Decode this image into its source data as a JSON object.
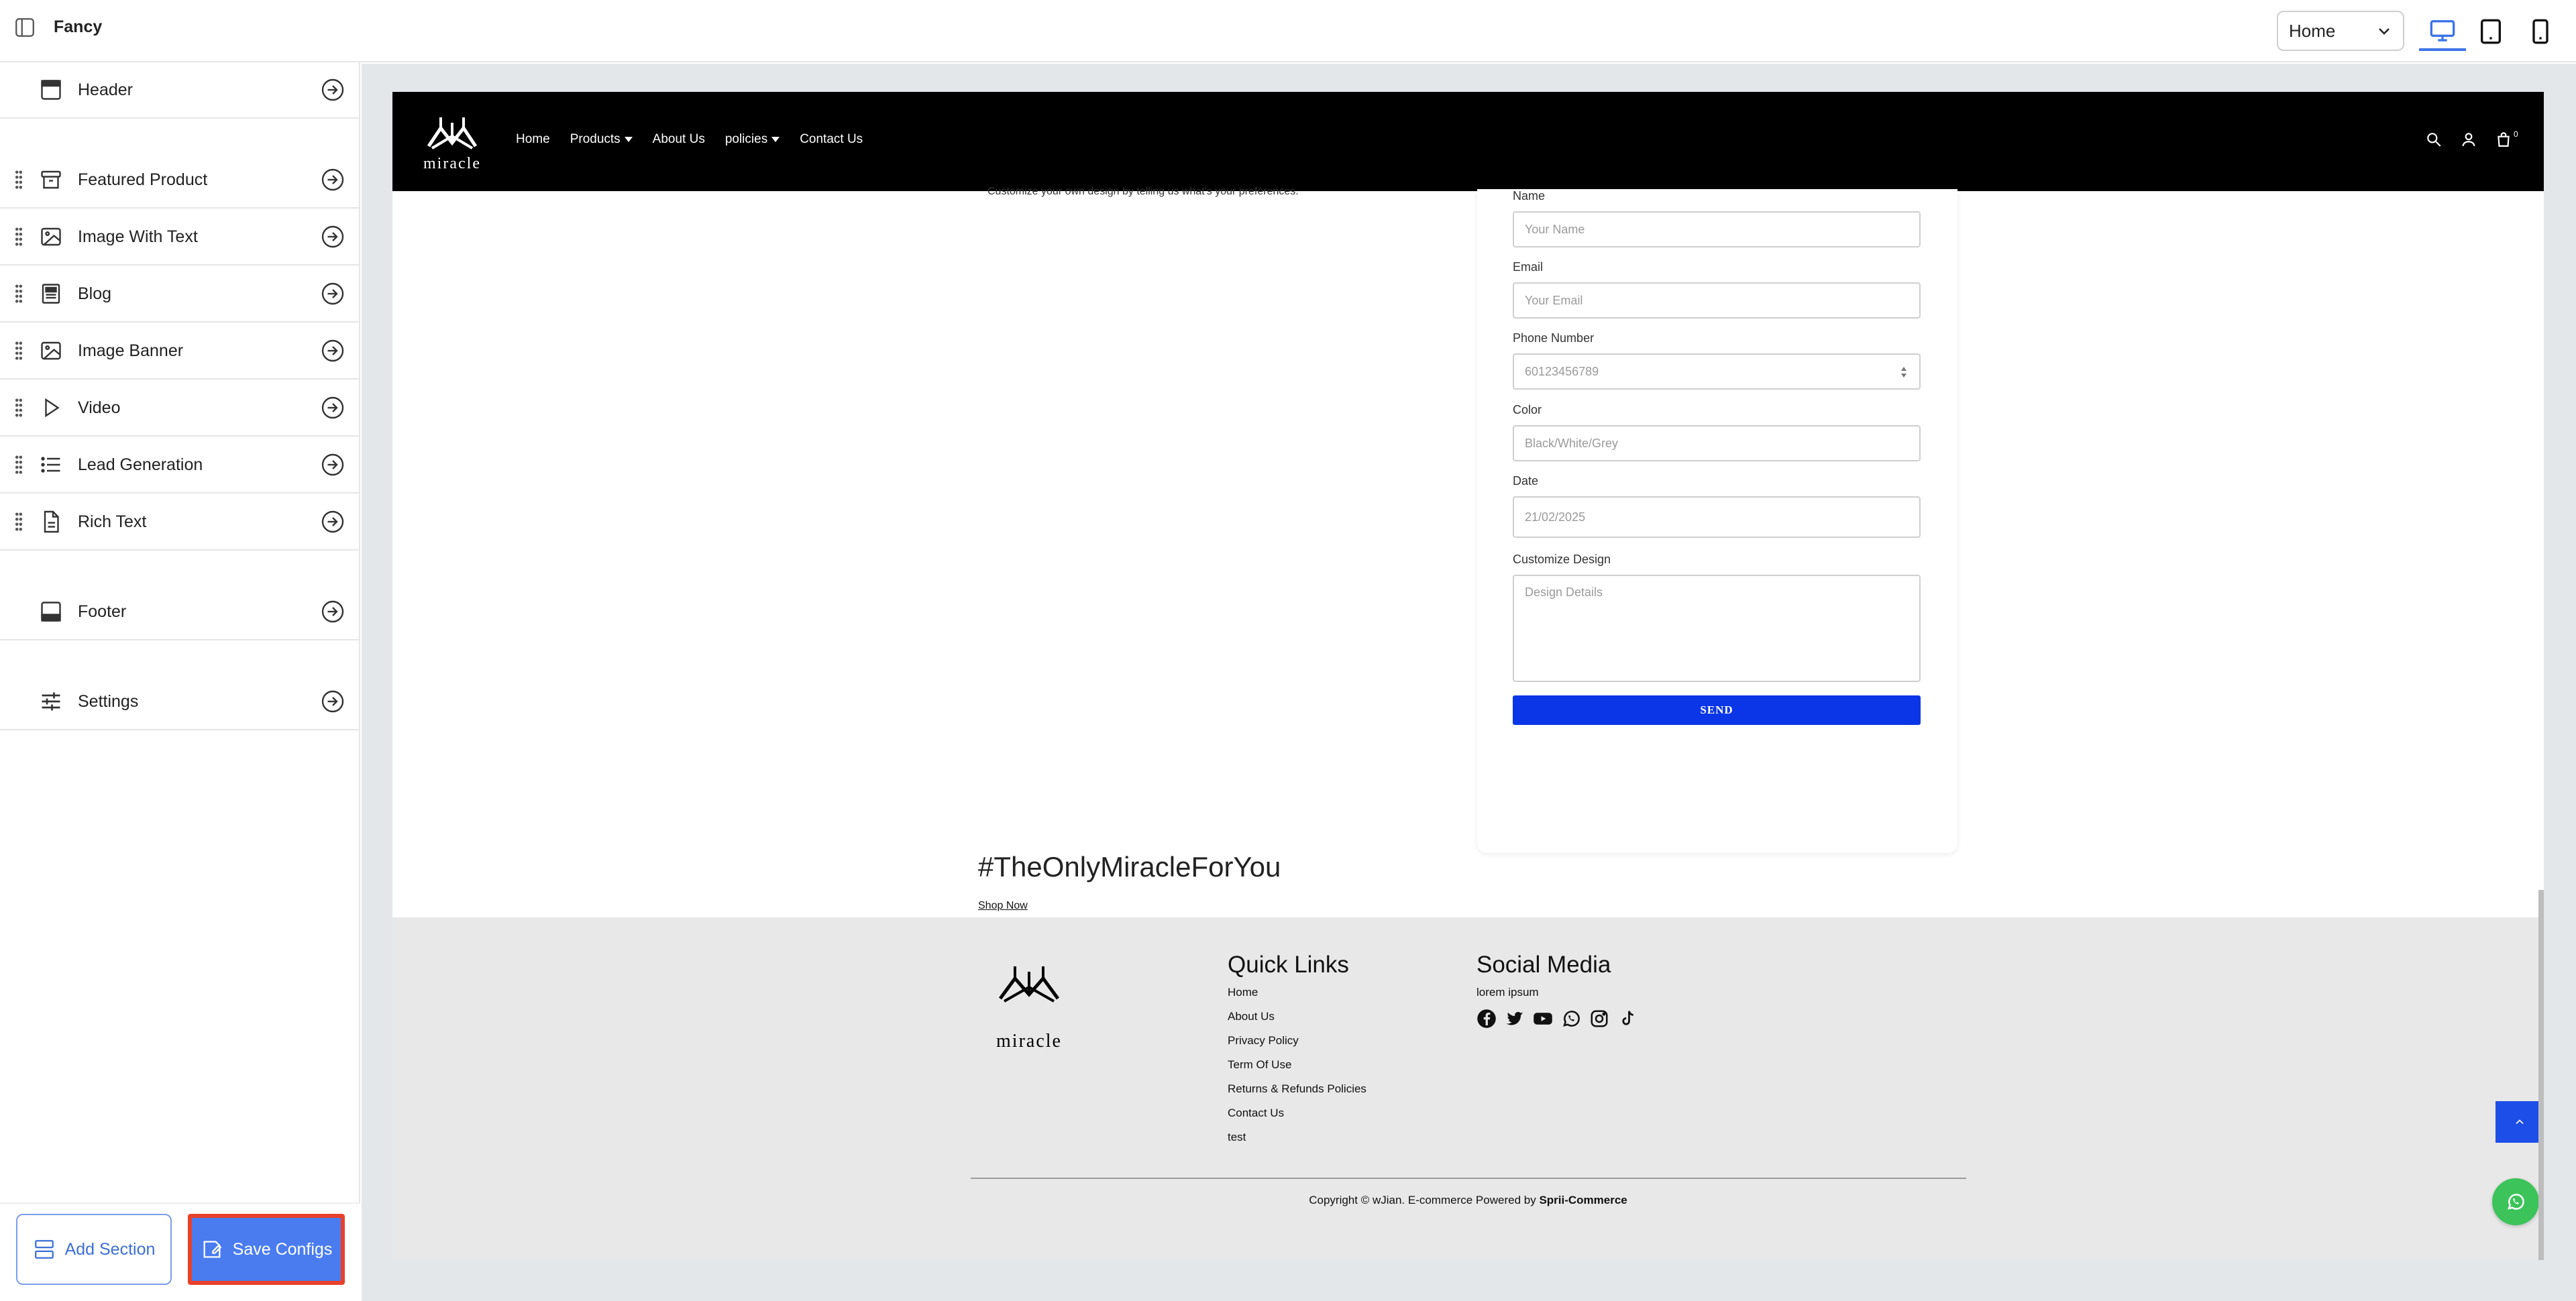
{
  "app": {
    "title": "Fancy"
  },
  "page_select": {
    "value": "Home"
  },
  "sidebar": {
    "items": [
      {
        "label": "Header",
        "icon": "header-icon"
      },
      {
        "label": "Featured Product",
        "icon": "archive-icon"
      },
      {
        "label": "Image With Text",
        "icon": "image-icon"
      },
      {
        "label": "Blog",
        "icon": "blog-icon"
      },
      {
        "label": "Image Banner",
        "icon": "image-icon"
      },
      {
        "label": "Video",
        "icon": "play-icon"
      },
      {
        "label": "Lead Generation",
        "icon": "list-icon"
      },
      {
        "label": "Rich Text",
        "icon": "document-icon"
      },
      {
        "label": "Footer",
        "icon": "footer-icon"
      },
      {
        "label": "Settings",
        "icon": "sliders-icon"
      }
    ],
    "add_section_label": "Add Section",
    "save_configs_label": "Save Configs"
  },
  "site": {
    "logo_text": "miracle",
    "nav": [
      "Home",
      "Products",
      "About Us",
      "policies",
      "Contact Us"
    ],
    "cart_count": "0",
    "intro": "Customize your own design by telling us what's your preferences.",
    "form": {
      "name_label": "Name",
      "name_placeholder": "Your Name",
      "email_label": "Email",
      "email_placeholder": "Your Email",
      "phone_label": "Phone Number",
      "phone_placeholder": "60123456789",
      "color_label": "Color",
      "color_placeholder": "Black/White/Grey",
      "date_label": "Date",
      "date_value": "21/02/2025",
      "design_label": "Customize Design",
      "design_placeholder": "Design Details",
      "send_label": "SEND"
    },
    "tagline": "#TheOnlyMiracleForYou",
    "shop_now": "Shop Now",
    "footer": {
      "quick_links_title": "Quick Links",
      "quick_links": [
        "Home",
        "About Us",
        "Privacy Policy",
        "Term Of Use",
        "Returns & Refunds Policies",
        "Contact Us",
        "test"
      ],
      "social_title": "Social Media",
      "social_text": "lorem ipsum",
      "social_icons": [
        "facebook-icon",
        "twitter-icon",
        "youtube-icon",
        "whatsapp-icon",
        "instagram-icon",
        "tiktok-icon"
      ],
      "copyright_prefix": "Copyright © wJian. E-commerce Powered by ",
      "copyright_brand": "Sprii-Commerce"
    }
  },
  "colors": {
    "accent": "#4a7cf0",
    "send": "#0a36e8",
    "highlight": "#e8402a",
    "whatsapp": "#3cc35a"
  }
}
